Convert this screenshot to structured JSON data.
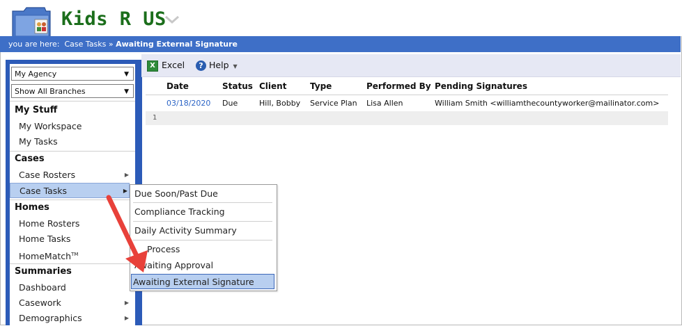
{
  "app": {
    "title": "Kids R US"
  },
  "breadcrumb": {
    "prefix": "you are here:",
    "parent": "Case Tasks",
    "separator": "»",
    "current": "Awaiting External Signature"
  },
  "sidebar": {
    "agency_select": "My Agency",
    "branch_select": "Show All Branches",
    "sections": [
      {
        "heading": "My Stuff",
        "items": [
          "My Workspace",
          "My Tasks"
        ]
      },
      {
        "heading": "Cases",
        "items": [
          "Case Rosters",
          "Case Tasks"
        ]
      },
      {
        "heading": "Homes",
        "items": [
          "Home Rosters",
          "Home Tasks",
          "HomeMatch"
        ]
      },
      {
        "heading": "Summaries",
        "items": [
          "Dashboard",
          "Casework",
          "Demographics"
        ]
      }
    ],
    "homematch_tm": "TM"
  },
  "toolbar": {
    "excel_label": "Excel",
    "help_label": "Help"
  },
  "table": {
    "columns": [
      "Date",
      "Status",
      "Client",
      "Type",
      "Performed By",
      "Pending Signatures"
    ],
    "rows": [
      [
        "03/18/2020",
        "Due",
        "Hill, Bobby",
        "Service Plan",
        "Lisa Allen",
        "William Smith <williamthecountyworker@mailinator.com>"
      ]
    ],
    "page_number": "1"
  },
  "flyout": {
    "items": [
      "Due Soon/Past Due",
      "Compliance Tracking",
      "Daily Activity Summary",
      "Process",
      "Awaiting Approval",
      "Awaiting External Signature"
    ],
    "selected": "Awaiting External Signature"
  },
  "colors": {
    "brand_green": "#1b6e1b",
    "nav_blue": "#3e6fc7",
    "sidebar_blue": "#2c5bb8",
    "highlight": "#b8cff0",
    "annotation_red": "#e8413a"
  }
}
